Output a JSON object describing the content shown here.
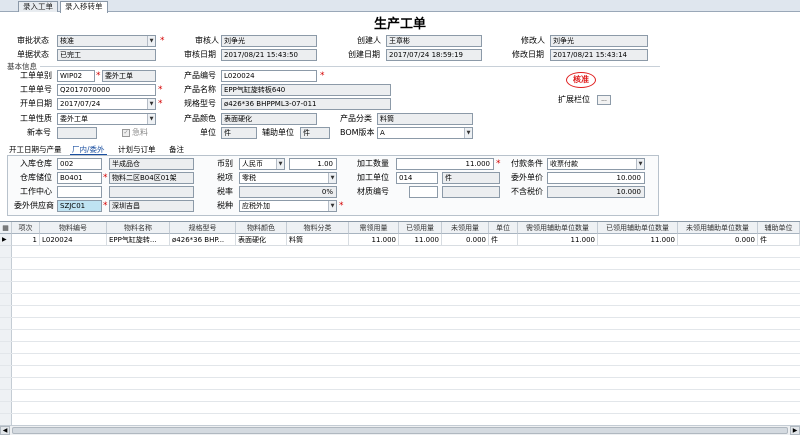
{
  "tabs": [
    {
      "label": "录入工单"
    },
    {
      "label": "录入移转单"
    }
  ],
  "title": "生产工单",
  "header": {
    "review_status_label": "审批状态",
    "review_status_value": "核准",
    "reviewer_label": "审核人",
    "reviewer_value": "刘争光",
    "creator_label": "创建人",
    "creator_value": "王章彬",
    "modifier_label": "修改人",
    "modifier_value": "刘争光",
    "doc_status_label": "单据状态",
    "doc_status_value": "已完工",
    "review_date_label": "审核日期",
    "review_date_value": "2017/08/21 15:43:50",
    "create_date_label": "创建日期",
    "create_date_value": "2017/07/24 18:59:19",
    "modify_date_label": "修改日期",
    "modify_date_value": "2017/08/21 15:43:14"
  },
  "basic_info": {
    "section_label": "基本信息",
    "order_type_label": "工单单别",
    "order_type_code": "WIP02",
    "order_type_name": "委外工单",
    "order_no_label": "工单单号",
    "order_no_value": "Q2017070000",
    "start_date_label": "开单日期",
    "start_date_value": "2017/07/24",
    "nature_label": "工单性质",
    "nature_value": "委外工单",
    "version_label": "新本号",
    "version_value": "",
    "urgent_label": "急料",
    "product_no_label": "产品编号",
    "product_no_value": "L020024",
    "product_name_label": "产品名称",
    "product_name_value": "EPP气缸旋转板640",
    "spec_label": "规格型号",
    "spec_value": "ø426*36 BHPPML3-07-011",
    "color_label": "产品颜色",
    "color_value": "表面硬化",
    "category_label": "产品分类",
    "category_value": "料筒",
    "unit_label": "单位",
    "unit_value": "件",
    "aux_unit_label": "辅助单位",
    "aux_unit_value": "件",
    "bom_label": "BOM版本",
    "bom_value": "A",
    "stamp_text": "核准",
    "ext_label": "扩展栏位",
    "ext_button": "..."
  },
  "subtabs": [
    {
      "label": "开工日期与产量"
    },
    {
      "label": "厂内/委外"
    },
    {
      "label": "计划与订单"
    },
    {
      "label": "备注"
    }
  ],
  "outsourcing": {
    "warehouse_label": "入库仓库",
    "warehouse_code": "002",
    "warehouse_name": "半成品仓",
    "location_label": "仓库储位",
    "location_code": "B0401",
    "location_name": "物料二区B04区01架",
    "work_center_label": "工作中心",
    "work_center_value": "",
    "supplier_label": "委外供应商",
    "supplier_code": "SZJC01",
    "supplier_name": "深圳吉昌",
    "currency_label": "币别",
    "currency_value": "人民币",
    "rate_value": "1.00",
    "tax_type_label": "税项",
    "tax_type_value": "零税",
    "tax_rate_label": "税率",
    "tax_rate_value": "0%",
    "tax_kind_label": "税种",
    "tax_kind_value": "应税外加",
    "process_qty_label": "加工数量",
    "process_qty_value": "11.000",
    "process_unit_label": "加工单位",
    "process_unit_code": "014",
    "process_unit_name": "件",
    "material_no_label": "材质编号",
    "material_no_value": "",
    "payment_label": "付款条件",
    "payment_value": "收票付款",
    "unit_price_label": "委外单价",
    "unit_price_value": "10.000",
    "untaxed_price_label": "不含税价",
    "untaxed_price_value": "10.000"
  },
  "table": {
    "columns": [
      "项次",
      "物料编号",
      "物料名称",
      "规格型号",
      "物料颜色",
      "物料分类",
      "需领用量",
      "已领用量",
      "未领用量",
      "单位",
      "需领用辅助单位数量",
      "已领用辅助单位数量",
      "未领用辅助单位数量",
      "辅助单位"
    ],
    "rows": [
      [
        "1",
        "L020024",
        "EPP气缸旋转...",
        "ø426*36 BHP...",
        "表面硬化",
        "料筒",
        "11.000",
        "11.000",
        "0.000",
        "件",
        "11.000",
        "11.000",
        "0.000",
        "件"
      ]
    ]
  }
}
